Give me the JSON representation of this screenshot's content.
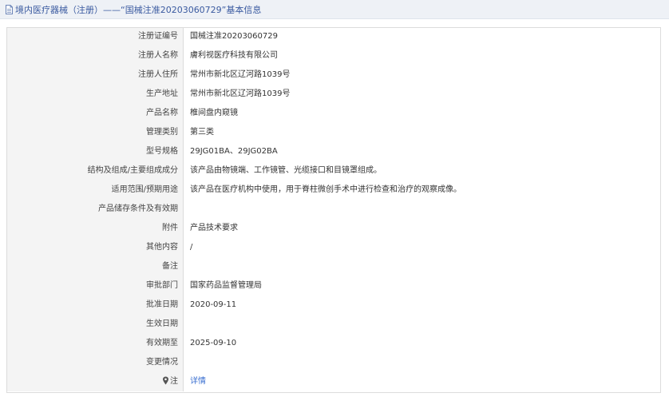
{
  "header": {
    "title": "境内医疗器械（注册）——“国械注准20203060729”基本信息",
    "icon": "document-icon"
  },
  "rows": [
    {
      "label": "注册证编号",
      "value": "国械注准20203060729"
    },
    {
      "label": "注册人名称",
      "value": "膚利视医疗科技有限公司"
    },
    {
      "label": "注册人住所",
      "value": "常州市新北区辽河路1039号"
    },
    {
      "label": "生产地址",
      "value": "常州市新北区辽河路1039号"
    },
    {
      "label": "产品名称",
      "value": "椎间盘内窥镜"
    },
    {
      "label": "管理类别",
      "value": "第三类"
    },
    {
      "label": "型号规格",
      "value": "29JG01BA、29JG02BA"
    },
    {
      "label": "结构及组成/主要组成成分",
      "value": "该产品由物镜端、工作镜管、光缆接口和目镜罩组成。"
    },
    {
      "label": "适用范围/预期用途",
      "value": "该产品在医疗机构中使用，用于脊柱微创手术中进行检查和治疗的观察成像。"
    },
    {
      "label": "产品储存条件及有效期",
      "value": ""
    },
    {
      "label": "附件",
      "value": "产品技术要求"
    },
    {
      "label": "其他内容",
      "value": "/"
    },
    {
      "label": "备注",
      "value": ""
    },
    {
      "label": "审批部门",
      "value": "国家药品监督管理局"
    },
    {
      "label": "批准日期",
      "value": "2020-09-11"
    },
    {
      "label": "生效日期",
      "value": ""
    },
    {
      "label": "有效期至",
      "value": "2025-09-10"
    },
    {
      "label": "变更情况",
      "value": ""
    }
  ],
  "note_row": {
    "label": "注",
    "icon": "note-icon",
    "link": "详情"
  },
  "colors": {
    "title_text": "#3a5aa0",
    "title_bg": "#eef1f6",
    "label_bg": "#f4f4f4",
    "link": "#3a6fd0"
  }
}
